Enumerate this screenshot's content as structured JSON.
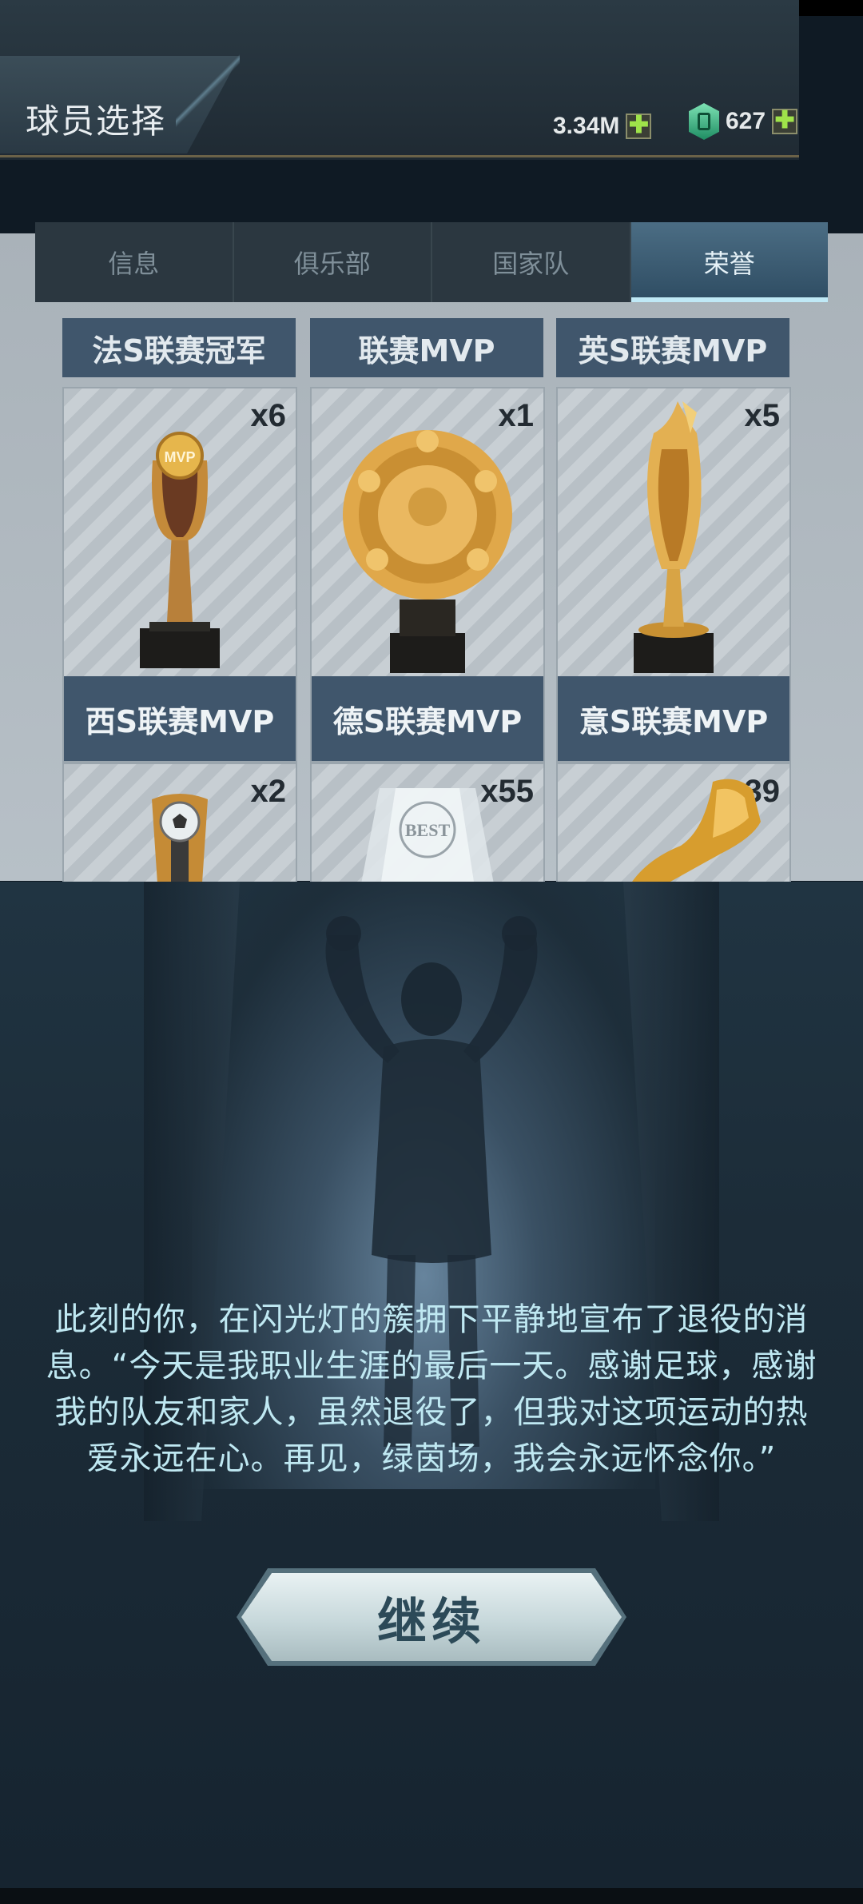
{
  "header": {
    "title": "球员选择",
    "coins": "3.34M",
    "gems": "627",
    "plus_symbol": "✚"
  },
  "tabs": [
    {
      "label": "信息",
      "active": false
    },
    {
      "label": "俱乐部",
      "active": false
    },
    {
      "label": "国家队",
      "active": false
    },
    {
      "label": "荣誉",
      "active": true
    }
  ],
  "top_row_labels": [
    "法S联赛冠军",
    "联赛MVP",
    "英S联赛MVP"
  ],
  "honors": [
    {
      "name": "西S联赛MVP",
      "count": "x6",
      "icon": "mvp-trophy"
    },
    {
      "name": "德S联赛MVP",
      "count": "x1",
      "icon": "shield-plate-trophy"
    },
    {
      "name": "意S联赛MVP",
      "count": "x5",
      "icon": "swirl-trophy"
    },
    {
      "name": "",
      "count": "x2",
      "icon": "ball-trophy"
    },
    {
      "name": "",
      "count": "x55",
      "icon": "best-crystal-trophy"
    },
    {
      "name": "",
      "count": "x39",
      "icon": "golden-boot-trophy"
    }
  ],
  "best_badge_text": "BEST",
  "mvp_badge_text": "MVP",
  "story": {
    "text": "此刻的你，在闪光灯的簇拥下平静地宣布了退役的消息。“今天是我职业生涯的最后一天。感谢足球，感谢我的队友和家人，虽然退役了，但我对这项运动的热爱永远在心。再见，绿茵场，我会永远怀念你。”"
  },
  "continue_label": "继续",
  "colors": {
    "accent_text": "#bfe8f2",
    "label_bar": "#40566c",
    "active_tab": "#4b6d84",
    "gold": "#d9a93a"
  }
}
